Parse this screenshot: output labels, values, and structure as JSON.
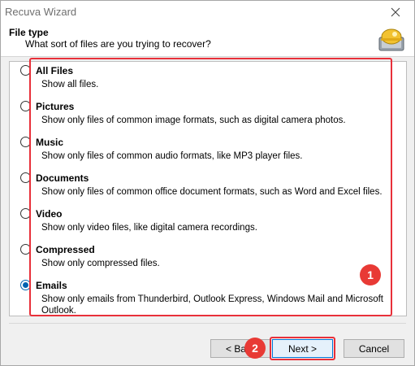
{
  "window": {
    "title": "Recuva Wizard"
  },
  "header": {
    "title": "File type",
    "subtitle": "What sort of files are you trying to recover?"
  },
  "options": [
    {
      "label": "All Files",
      "desc": "Show all files.",
      "checked": false
    },
    {
      "label": "Pictures",
      "desc": "Show only files of common image formats, such as digital camera photos.",
      "checked": false
    },
    {
      "label": "Music",
      "desc": "Show only files of common audio formats, like MP3 player files.",
      "checked": false
    },
    {
      "label": "Documents",
      "desc": "Show only files of common office document formats, such as Word and Excel files.",
      "checked": false
    },
    {
      "label": "Video",
      "desc": "Show only video files, like digital camera recordings.",
      "checked": false
    },
    {
      "label": "Compressed",
      "desc": "Show only compressed files.",
      "checked": false
    },
    {
      "label": "Emails",
      "desc": "Show only emails from Thunderbird, Outlook Express, Windows Mail and Microsoft Outlook.",
      "checked": true
    }
  ],
  "annotations": {
    "badge1": "1",
    "badge2": "2"
  },
  "buttons": {
    "back": "< Back",
    "next": "Next >",
    "cancel": "Cancel"
  },
  "colors": {
    "highlight": "#e8303a",
    "accent": "#0063b1"
  }
}
